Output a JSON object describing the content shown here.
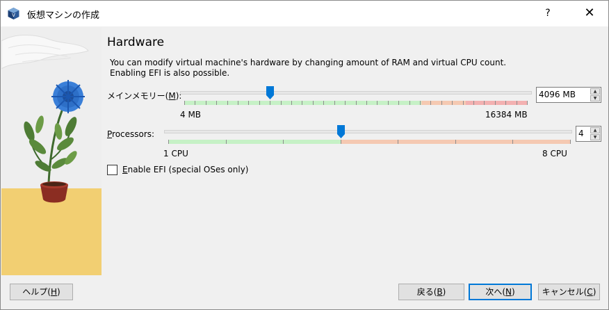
{
  "window": {
    "title": "仮想マシンの作成"
  },
  "titlebar": {
    "help_label": "?",
    "close_label": "✕"
  },
  "page": {
    "heading": "Hardware",
    "description_line1": "You can modify virtual machine's hardware by changing amount of RAM and virtual CPU count.",
    "description_line2": "Enabling EFI is also possible."
  },
  "memory": {
    "label_pre": "メインメモリー(",
    "label_mnemonic": "M",
    "label_post": "):",
    "value": "4096 MB",
    "min_label": "4 MB",
    "max_label": "16384 MB",
    "min_mb": 4,
    "max_mb": 16384,
    "current_mb": 4096,
    "recommended_max_mb": 12288,
    "colors": {
      "ok": "#c6f1c6",
      "warn": "#f5c9b2",
      "bad": "#f3b1b1"
    }
  },
  "processors": {
    "label_mnemonic": "P",
    "label_rest": "rocessors:",
    "value": "4",
    "min_label": "1 CPU",
    "max_label": "8 CPU",
    "min": 1,
    "max": 8,
    "current": 4,
    "colors": {
      "ok": "#c6f1c6",
      "warn": "#f5c9b2"
    }
  },
  "efi": {
    "label_mnemonic": "E",
    "label_rest": "nable EFI (special OSes only)",
    "checked": false
  },
  "footer": {
    "help": {
      "pre": "ヘルプ(",
      "mnemonic": "H",
      "post": ")"
    },
    "back": {
      "pre": "戻る(",
      "mnemonic": "B",
      "post": ")"
    },
    "next": {
      "pre": "次へ(",
      "mnemonic": "N",
      "post": ")"
    },
    "cancel": {
      "pre": "キャンセル(",
      "mnemonic": "C",
      "post": ")"
    }
  },
  "accent_color": "#0078d7"
}
